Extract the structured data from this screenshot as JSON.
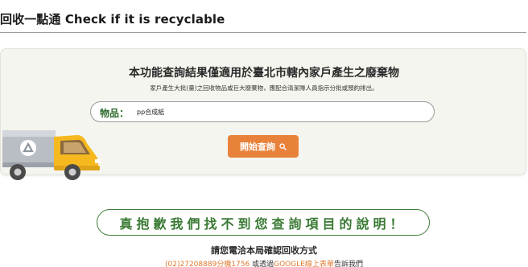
{
  "header": {
    "title": "回收一點通 Check if it is recyclable"
  },
  "search_panel": {
    "heading": "本功能查詢結果僅適用於臺北市轄內家戶產生之廢棄物",
    "note": "家戶產生大批(量)之回收物品或巨大廢棄物，應配合清潔隊人員指示分批或預約排出。",
    "field_label": "物品：",
    "field_value": "pp合成紙",
    "button_label": "開始查詢"
  },
  "result": {
    "message": "真抱歉我們找不到您查詢項目的說明！"
  },
  "contact": {
    "heading": "請您電洽本局確認回收方式",
    "phone_text": "(02)27208889分機1756",
    "middle_text": " 或透過",
    "form_link_text": "GOOGLE線上表單",
    "end_text": "告訴我們"
  },
  "colors": {
    "accent_orange": "#e8823a",
    "result_green": "#3a7a34",
    "panel_bg": "#f5f5ef"
  },
  "icons": {
    "button_icon": "search-icon",
    "illustration": "recycling-truck-icon"
  }
}
